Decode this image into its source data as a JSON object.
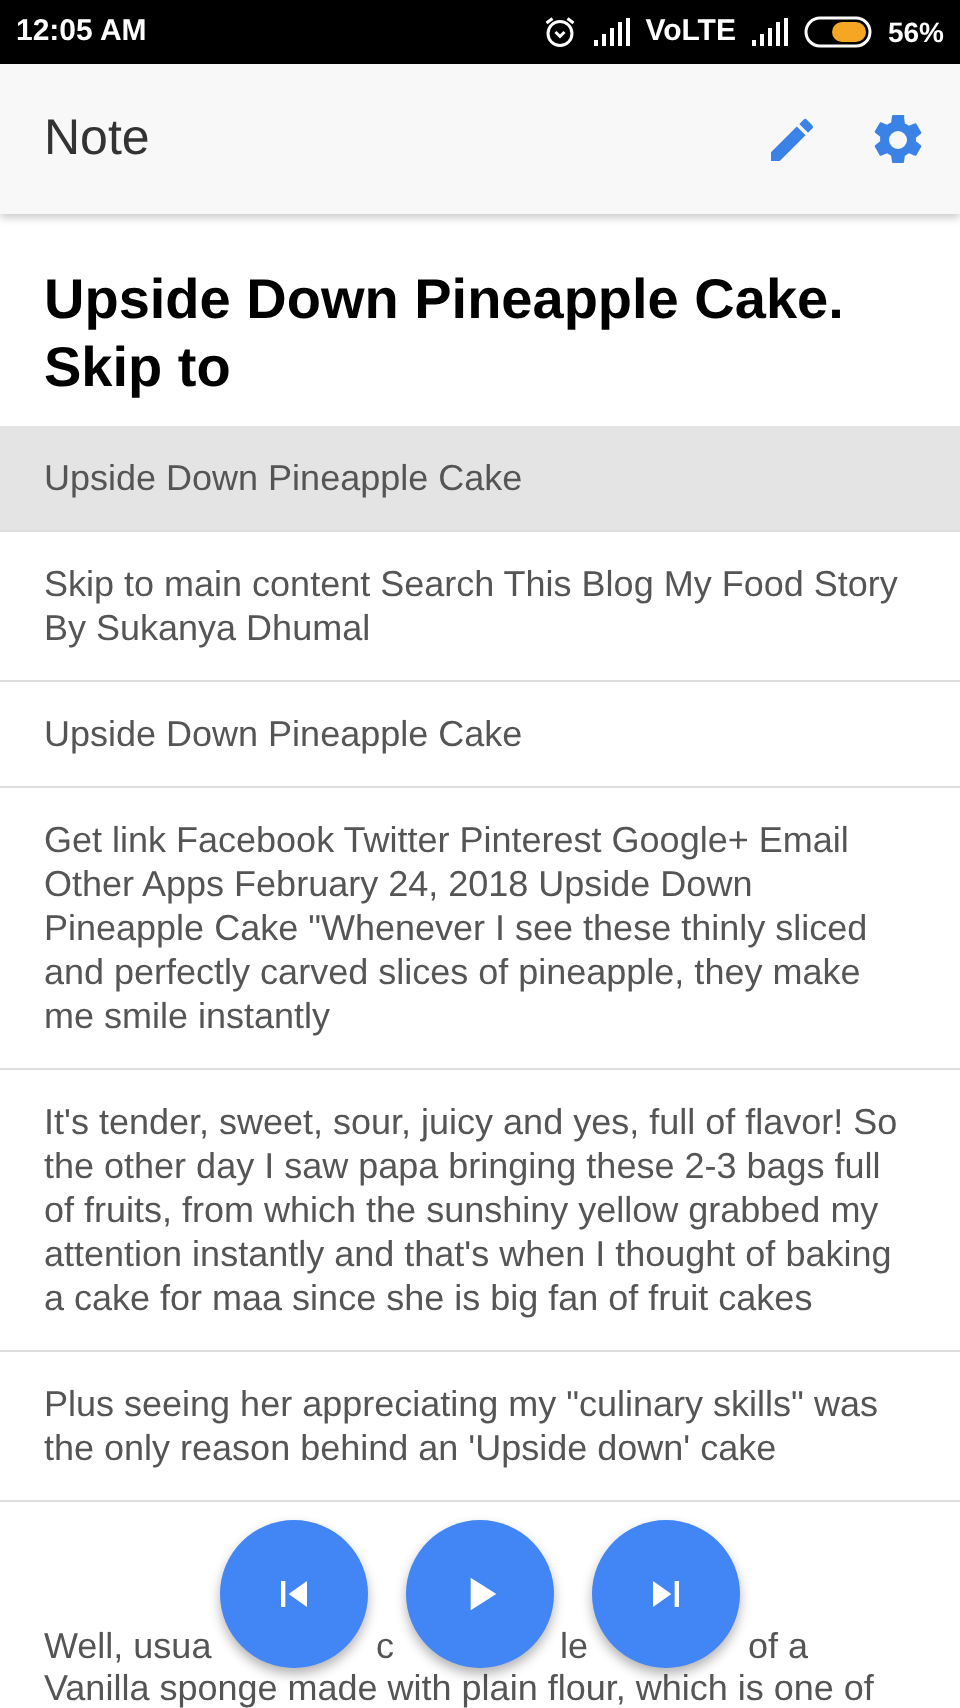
{
  "status_bar": {
    "time": "12:05 AM",
    "network": "VoLTE",
    "battery": "56%"
  },
  "app_bar": {
    "title": "Note"
  },
  "note": {
    "title": "Upside Down Pineapple Cake. Skip to"
  },
  "paragraphs": [
    {
      "text": "Upside Down Pineapple Cake",
      "selected": true
    },
    {
      "text": "Skip to main content Search This Blog My Food Story By Sukanya Dhumal",
      "selected": false
    },
    {
      "text": "Upside Down Pineapple Cake",
      "selected": false
    },
    {
      "text": "Get link Facebook Twitter Pinterest Google+ Email Other Apps February 24, 2018 Upside Down Pineapple Cake  \"Whenever I see these thinly sliced and perfectly carved slices of pineapple, they make me smile instantly",
      "selected": false
    },
    {
      "text": "It's tender, sweet, sour, juicy and yes, full of flavor! So the other day I saw papa bringing these 2-3 bags full of fruits, from which the sunshiny yellow grabbed my attention instantly and that's when I thought of baking a cake for maa since she is big fan of fruit cakes",
      "selected": false
    },
    {
      "text": "Plus seeing her appreciating my \"culinary skills\" was the only reason behind an 'Upside down' cake",
      "selected": false
    },
    {
      "kind": "covered",
      "fragments": [
        "Well, usua",
        "c",
        "le",
        "of a"
      ],
      "text": "Vanilla sponge made with plain flour, which is one of",
      "selected": false
    }
  ],
  "player": [
    {
      "kind": "previous"
    },
    {
      "kind": "play"
    },
    {
      "kind": "next"
    }
  ]
}
